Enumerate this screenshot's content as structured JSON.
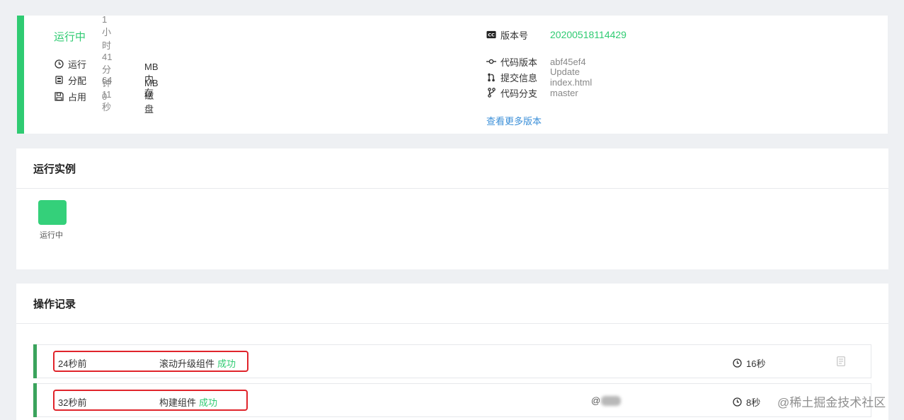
{
  "status": {
    "title": "运行中",
    "run_label": "运行",
    "run_value": "1小时41分钟11秒",
    "alloc_label": "分配",
    "alloc_value": "64",
    "alloc_unit": "MB 内存",
    "used_label": "占用",
    "used_value": "0",
    "used_unit": "MB 磁盘",
    "version_label": "版本号",
    "version_value": "20200518114429",
    "code_version_label": "代码版本",
    "code_version_value": "abf45ef4",
    "commit_label": "提交信息",
    "commit_value": "Update index.html",
    "branch_label": "代码分支",
    "branch_value": "master",
    "more_versions": "查看更多版本",
    "accent_color": "#2fcb72"
  },
  "instances": {
    "title": "运行实例",
    "items": [
      {
        "label": "运行中",
        "color": "#34d07a"
      }
    ]
  },
  "operations": {
    "title": "操作记录",
    "rows": [
      {
        "time": "24秒前",
        "action": "滚动升级组件",
        "result": "成功",
        "user": "",
        "duration": "16秒"
      },
      {
        "time": "32秒前",
        "action": "构建组件",
        "result": "成功",
        "user": "@",
        "duration": "8秒"
      }
    ]
  },
  "watermark": "@稀土掘金技术社区"
}
